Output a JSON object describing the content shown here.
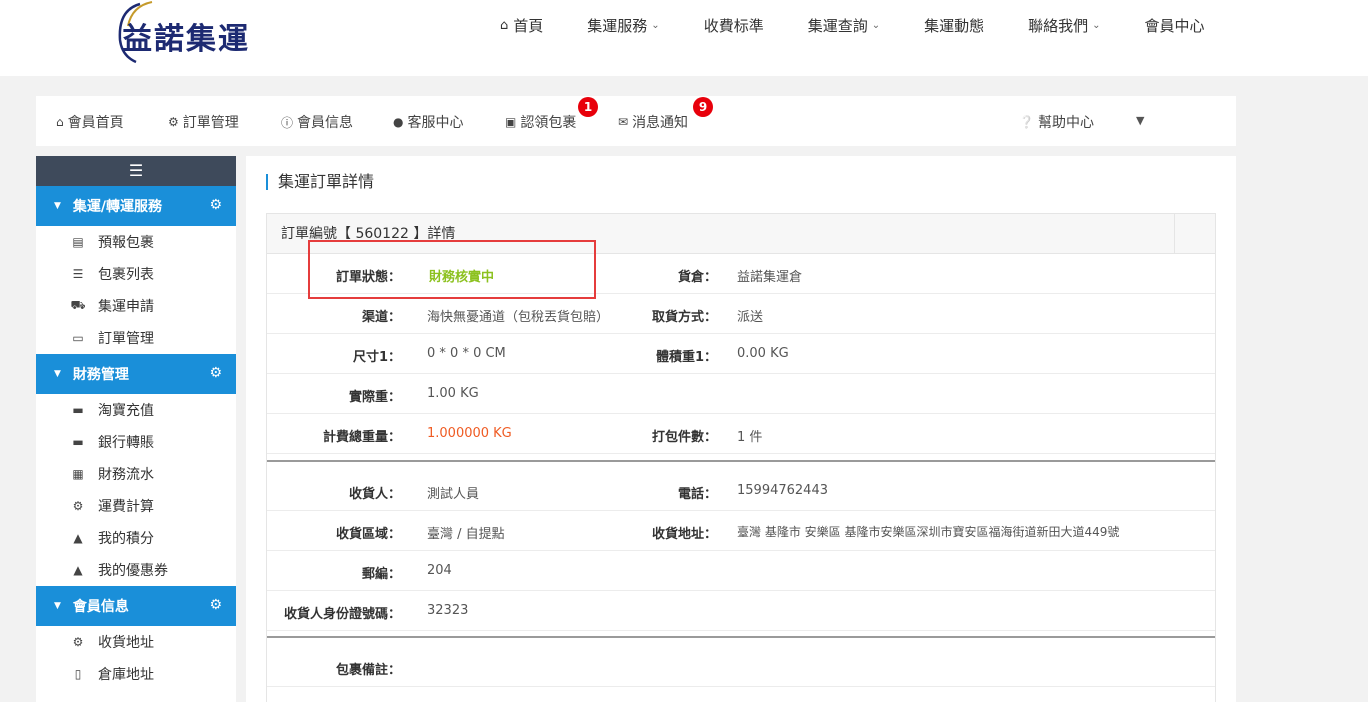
{
  "logo": {
    "text": "益諾集運"
  },
  "topnav": [
    {
      "label": "首頁",
      "icon": "home-icon",
      "has_dropdown": false
    },
    {
      "label": "集運服務",
      "has_dropdown": true
    },
    {
      "label": "收費标準",
      "has_dropdown": false
    },
    {
      "label": "集運查詢",
      "has_dropdown": true
    },
    {
      "label": "集運動態",
      "has_dropdown": false
    },
    {
      "label": "聯絡我們",
      "has_dropdown": true
    },
    {
      "label": "會員中心",
      "has_dropdown": false
    }
  ],
  "memberbar": {
    "items": [
      {
        "label": "會員首頁",
        "icon": "home-icon"
      },
      {
        "label": "訂單管理",
        "icon": "gear-icon"
      },
      {
        "label": "會員信息",
        "icon": "info-icon"
      },
      {
        "label": "客服中心",
        "icon": "user-icon"
      },
      {
        "label": "認領包裹",
        "icon": "archive-icon",
        "badge": "1"
      },
      {
        "label": "消息通知",
        "icon": "envelope-icon",
        "badge": "9"
      }
    ],
    "help": {
      "label": "幫助中心",
      "icon": "question-icon"
    }
  },
  "sidebar": {
    "sections": [
      {
        "title": "集運/轉運服務",
        "items": [
          {
            "label": "預報包裹",
            "icon": "inbox-icon"
          },
          {
            "label": "包裹列表",
            "icon": "list-icon"
          },
          {
            "label": "集運申請",
            "icon": "truck-icon"
          },
          {
            "label": "訂單管理",
            "icon": "book-icon"
          }
        ]
      },
      {
        "title": "財務管理",
        "items": [
          {
            "label": "淘寶充值",
            "icon": "credit-card-icon"
          },
          {
            "label": "銀行轉賬",
            "icon": "credit-card-icon"
          },
          {
            "label": "財務流水",
            "icon": "bar-chart-icon"
          },
          {
            "label": "運費計算",
            "icon": "cogs-icon"
          },
          {
            "label": "我的積分",
            "icon": "gift-icon"
          },
          {
            "label": "我的優惠券",
            "icon": "gift-icon"
          }
        ]
      },
      {
        "title": "會員信息",
        "items": [
          {
            "label": "收貨地址",
            "icon": "cogs-icon"
          },
          {
            "label": "倉庫地址",
            "icon": "building-icon"
          }
        ]
      }
    ]
  },
  "main": {
    "title": "集運訂單詳情",
    "order_header": "訂單編號【 560122 】詳情",
    "fields": {
      "status_label": "訂單狀態：",
      "status_value": "財務核實中",
      "warehouse_label": "貨倉：",
      "warehouse_value": "益諾集運倉",
      "channel_label": "渠道：",
      "channel_value": "海快無憂通道（包稅丟貨包賠）",
      "pickup_label": "取貨方式：",
      "pickup_value": "派送",
      "size_label": "尺寸1：",
      "size_value": "0 * 0 * 0 CM",
      "volweight_label": "體積重1：",
      "volweight_value": "0.00 KG",
      "actual_label": "實際重：",
      "actual_value": "1.00 KG",
      "billweight_label": "計費總重量：",
      "billweight_value": "1.000000 KG",
      "pieces_label": "打包件數：",
      "pieces_value": "1 件",
      "recipient_label": "收貨人：",
      "recipient_value": "測試人員",
      "phone_label": "電話：",
      "phone_value": "15994762443",
      "region_label": "收貨區域：",
      "region_value": "臺灣 / 自提點",
      "address_label": "收貨地址：",
      "address_value": "臺灣 基隆市 安樂區 基隆市安樂區深圳市寶安區福海街道新田大道449號",
      "zip_label": "郵編：",
      "zip_value": "204",
      "idno_label": "收貨人身份證號碼：",
      "idno_value": "32323",
      "remark_label": "包裹備註："
    }
  },
  "colors": {
    "accent": "#1a8fd9",
    "status": "#8cc11f",
    "weight": "#ef5b23",
    "badge": "#e8000b",
    "highlight": "#e53c3c"
  }
}
